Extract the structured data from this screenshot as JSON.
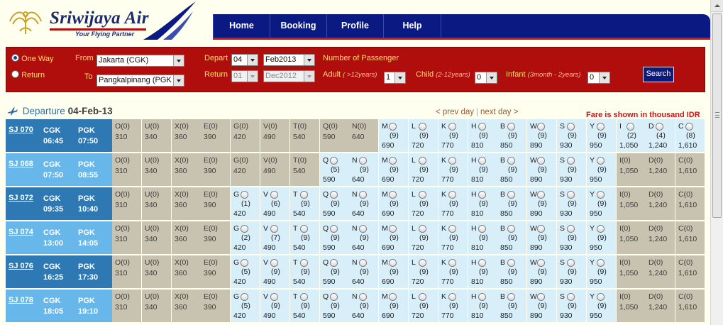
{
  "brand": {
    "name": "Sriwijaya Air",
    "tagline": "Your Flying Partner"
  },
  "nav": {
    "items": [
      "Home",
      "Booking",
      "Profile",
      "Help"
    ]
  },
  "search": {
    "trip_options": [
      {
        "label": "One Way",
        "selected": true
      },
      {
        "label": "Return",
        "selected": false
      }
    ],
    "from_label": "From",
    "from_value": "Jakarta (CGK)",
    "to_label": "To",
    "to_value": "Pangkalpinang (PGK",
    "depart_label": "Depart",
    "depart_day": "04",
    "depart_month": "Feb2013",
    "return_label": "Return",
    "return_day": "01",
    "return_month": "Dec2012",
    "passenger_heading": "Number of Passenger",
    "adult_label": "Adult",
    "adult_hint": "( >12years)",
    "adult_value": "1",
    "child_label": "Child",
    "child_hint": "(2-12years)",
    "child_value": "0",
    "infant_label": "Infant",
    "infant_hint": "(3month - 2years)",
    "infant_value": "0",
    "search_button": "Search"
  },
  "results": {
    "departure_label": "Departure",
    "departure_date": "04-Feb-13",
    "prev_day": "< prev day",
    "separator": "|",
    "next_day": "next day >",
    "fare_note": "Fare is shown in thousand IDR"
  },
  "flights": [
    {
      "no": "SJ 070",
      "from": "CGK",
      "dep": "06:45",
      "to": "PGK",
      "arr": "07:50",
      "style": "dark",
      "classes": [
        [
          "O",
          "0",
          "310",
          false
        ],
        [
          "U",
          "0",
          "340",
          false
        ],
        [
          "X",
          "0",
          "360",
          false
        ],
        [
          "E",
          "0",
          "390",
          false
        ],
        [
          "G",
          "0",
          "420",
          false
        ],
        [
          "V",
          "0",
          "490",
          false
        ],
        [
          "T",
          "0",
          "540",
          false
        ],
        [
          "Q",
          "0",
          "590",
          false
        ],
        [
          "N",
          "0",
          "640",
          false
        ],
        [
          "M",
          "9",
          "690",
          true
        ],
        [
          "L",
          "9",
          "720",
          true
        ],
        [
          "K",
          "9",
          "770",
          true
        ],
        [
          "H",
          "9",
          "810",
          true
        ],
        [
          "B",
          "9",
          "850",
          true
        ],
        [
          "W",
          "9",
          "890",
          true
        ],
        [
          "S",
          "9",
          "930",
          true
        ],
        [
          "Y",
          "9",
          "950",
          true
        ],
        [
          "I",
          "2",
          "1,050",
          true
        ],
        [
          "D",
          "4",
          "1,240",
          true
        ],
        [
          "C",
          "8",
          "1,610",
          true
        ]
      ]
    },
    {
      "no": "SJ 068",
      "from": "CGK",
      "dep": "07:50",
      "to": "PGK",
      "arr": "08:55",
      "style": "light",
      "classes": [
        [
          "O",
          "0",
          "310",
          false
        ],
        [
          "U",
          "0",
          "340",
          false
        ],
        [
          "X",
          "0",
          "360",
          false
        ],
        [
          "E",
          "0",
          "390",
          false
        ],
        [
          "G",
          "0",
          "420",
          false
        ],
        [
          "V",
          "0",
          "490",
          false
        ],
        [
          "T",
          "0",
          "540",
          false
        ],
        [
          "Q",
          "5",
          "590",
          true
        ],
        [
          "N",
          "9",
          "640",
          true
        ],
        [
          "M",
          "9",
          "690",
          true
        ],
        [
          "L",
          "9",
          "720",
          true
        ],
        [
          "K",
          "9",
          "770",
          true
        ],
        [
          "H",
          "9",
          "810",
          true
        ],
        [
          "B",
          "9",
          "850",
          true
        ],
        [
          "W",
          "9",
          "890",
          true
        ],
        [
          "S",
          "9",
          "930",
          true
        ],
        [
          "Y",
          "9",
          "950",
          true
        ],
        [
          "I",
          "0",
          "1,050",
          false
        ],
        [
          "D",
          "0",
          "1,240",
          false
        ],
        [
          "C",
          "0",
          "1,610",
          false
        ]
      ]
    },
    {
      "no": "SJ 072",
      "from": "CGK",
      "dep": "09:35",
      "to": "PGK",
      "arr": "10:40",
      "style": "dark",
      "classes": [
        [
          "O",
          "0",
          "310",
          false
        ],
        [
          "U",
          "0",
          "340",
          false
        ],
        [
          "X",
          "0",
          "360",
          false
        ],
        [
          "E",
          "0",
          "390",
          false
        ],
        [
          "G",
          "1",
          "420",
          true
        ],
        [
          "V",
          "6",
          "490",
          true
        ],
        [
          "T",
          "9",
          "540",
          true
        ],
        [
          "Q",
          "9",
          "590",
          true
        ],
        [
          "N",
          "9",
          "640",
          true
        ],
        [
          "M",
          "9",
          "690",
          true
        ],
        [
          "L",
          "9",
          "720",
          true
        ],
        [
          "K",
          "9",
          "770",
          true
        ],
        [
          "H",
          "9",
          "810",
          true
        ],
        [
          "B",
          "9",
          "850",
          true
        ],
        [
          "W",
          "9",
          "890",
          true
        ],
        [
          "S",
          "9",
          "930",
          true
        ],
        [
          "Y",
          "9",
          "950",
          true
        ],
        [
          "I",
          "0",
          "1,050",
          false
        ],
        [
          "D",
          "0",
          "1,240",
          false
        ],
        [
          "C",
          "0",
          "1,610",
          false
        ]
      ]
    },
    {
      "no": "SJ 074",
      "from": "CGK",
      "dep": "13:00",
      "to": "PGK",
      "arr": "14:05",
      "style": "light",
      "classes": [
        [
          "O",
          "0",
          "310",
          false
        ],
        [
          "U",
          "0",
          "340",
          false
        ],
        [
          "X",
          "0",
          "360",
          false
        ],
        [
          "E",
          "0",
          "390",
          false
        ],
        [
          "G",
          "2",
          "420",
          true
        ],
        [
          "V",
          "7",
          "490",
          true
        ],
        [
          "T",
          "9",
          "540",
          true
        ],
        [
          "Q",
          "9",
          "590",
          true
        ],
        [
          "N",
          "9",
          "640",
          true
        ],
        [
          "M",
          "9",
          "690",
          true
        ],
        [
          "L",
          "9",
          "720",
          true
        ],
        [
          "K",
          "9",
          "770",
          true
        ],
        [
          "H",
          "9",
          "810",
          true
        ],
        [
          "B",
          "9",
          "850",
          true
        ],
        [
          "W",
          "9",
          "890",
          true
        ],
        [
          "S",
          "9",
          "930",
          true
        ],
        [
          "Y",
          "9",
          "950",
          true
        ],
        [
          "I",
          "0",
          "1,050",
          false
        ],
        [
          "D",
          "0",
          "1,240",
          false
        ],
        [
          "C",
          "0",
          "1,610",
          false
        ]
      ]
    },
    {
      "no": "SJ 076",
      "from": "CGK",
      "dep": "16:25",
      "to": "PGK",
      "arr": "17:30",
      "style": "dark",
      "classes": [
        [
          "O",
          "0",
          "310",
          false
        ],
        [
          "U",
          "0",
          "340",
          false
        ],
        [
          "X",
          "0",
          "360",
          false
        ],
        [
          "E",
          "0",
          "390",
          false
        ],
        [
          "G",
          "5",
          "420",
          true
        ],
        [
          "V",
          "9",
          "490",
          true
        ],
        [
          "T",
          "9",
          "540",
          true
        ],
        [
          "Q",
          "9",
          "590",
          true
        ],
        [
          "N",
          "9",
          "640",
          true
        ],
        [
          "M",
          "9",
          "690",
          true
        ],
        [
          "L",
          "9",
          "720",
          true
        ],
        [
          "K",
          "9",
          "770",
          true
        ],
        [
          "H",
          "9",
          "810",
          true
        ],
        [
          "B",
          "9",
          "850",
          true
        ],
        [
          "W",
          "9",
          "890",
          true
        ],
        [
          "S",
          "9",
          "930",
          true
        ],
        [
          "Y",
          "9",
          "950",
          true
        ],
        [
          "I",
          "0",
          "1,050",
          false
        ],
        [
          "D",
          "0",
          "1,240",
          false
        ],
        [
          "C",
          "0",
          "1,610",
          false
        ]
      ]
    },
    {
      "no": "SJ 078",
      "from": "CGK",
      "dep": "18:05",
      "to": "PGK",
      "arr": "19:10",
      "style": "light",
      "classes": [
        [
          "O",
          "0",
          "310",
          false
        ],
        [
          "U",
          "0",
          "340",
          false
        ],
        [
          "X",
          "0",
          "360",
          false
        ],
        [
          "E",
          "0",
          "390",
          false
        ],
        [
          "G",
          "5",
          "420",
          true
        ],
        [
          "V",
          "9",
          "490",
          true
        ],
        [
          "T",
          "9",
          "540",
          true
        ],
        [
          "Q",
          "9",
          "590",
          true
        ],
        [
          "N",
          "9",
          "640",
          true
        ],
        [
          "M",
          "9",
          "690",
          true
        ],
        [
          "L",
          "9",
          "720",
          true
        ],
        [
          "K",
          "9",
          "770",
          true
        ],
        [
          "H",
          "9",
          "810",
          true
        ],
        [
          "B",
          "9",
          "850",
          true
        ],
        [
          "W",
          "9",
          "890",
          true
        ],
        [
          "S",
          "9",
          "930",
          true
        ],
        [
          "Y",
          "9",
          "950",
          true
        ],
        [
          "I",
          "0",
          "1,050",
          false
        ],
        [
          "D",
          "0",
          "1,240",
          false
        ],
        [
          "C",
          "0",
          "1,610",
          false
        ]
      ]
    }
  ],
  "colors": {
    "nav_bg": "#0b1a82",
    "panel_bg": "#b00d0d",
    "flight_dark": "#2e79b4",
    "flight_light": "#68b7ea",
    "unavailable": "#c8c2b0",
    "available": "#d8eef9",
    "fare_note": "#d41111"
  }
}
